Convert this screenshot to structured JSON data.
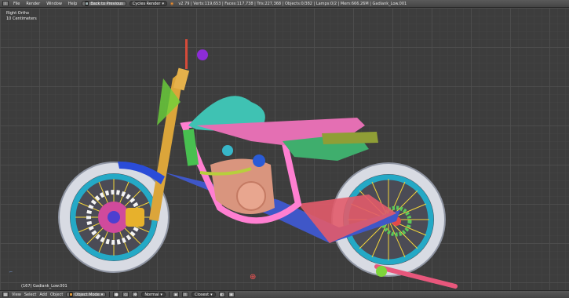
{
  "topbar": {
    "menu": [
      "File",
      "Render",
      "Window",
      "Help"
    ],
    "back_button": "Back to Previous",
    "engine": "Cycles Render",
    "stats": "v2.79 | Verts:119,653 | Faces:117,738 | Tris:227,368 | Objects:0/382 | Lamps:0/2 | Mem:666.26M | Gadiank_Low.001"
  },
  "viewport": {
    "view_name": "Right Ortho",
    "units": "10 Centimeters",
    "active_object": "(167) Gadiank_Low.001"
  },
  "bottombar": {
    "items": [
      "View",
      "Select",
      "Add",
      "Object"
    ],
    "mode": "Object Mode",
    "pivot": "Normal",
    "snap": "Closest"
  },
  "colors": {
    "background": "#3d3d3d",
    "tire": "#d9dce4",
    "rim": "#22a7c4",
    "spokes": "#f1d23a",
    "frame": "#ff7fd1",
    "tank": "#3fc2b3",
    "fork": "#d9a63a",
    "seat": "#e46fb3",
    "swingarm": "#3f57c8"
  }
}
